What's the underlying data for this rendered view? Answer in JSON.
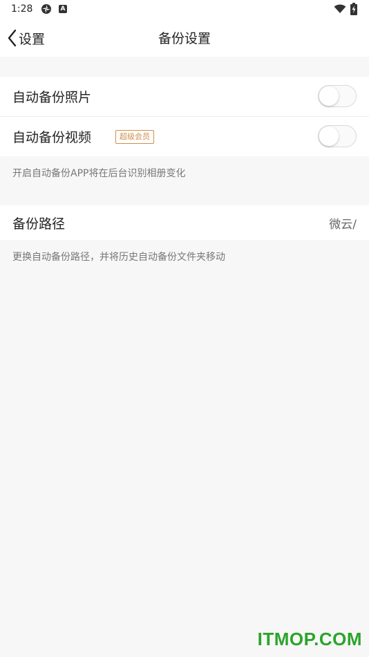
{
  "status_bar": {
    "time": "1:28",
    "icons": [
      "pinwheel-icon",
      "a-icon",
      "wifi-icon",
      "battery-charging-icon"
    ]
  },
  "nav": {
    "back_label": "设置",
    "title": "备份设置"
  },
  "settings": {
    "auto_backup_photos": {
      "label": "自动备份照片",
      "enabled": false
    },
    "auto_backup_videos": {
      "label": "自动备份视频",
      "badge": "超级会员",
      "enabled": false
    },
    "backup_hint": "开启自动备份APP将在后台识别相册变化",
    "backup_path": {
      "label": "备份路径",
      "value": "微云/"
    },
    "path_hint": "更换自动备份路径，并将历史自动备份文件夹移动"
  },
  "colors": {
    "badge": "#d18c4a",
    "background": "#f7f7f7",
    "watermark": "#2aa52a"
  },
  "watermark": "ITMOP.COM"
}
